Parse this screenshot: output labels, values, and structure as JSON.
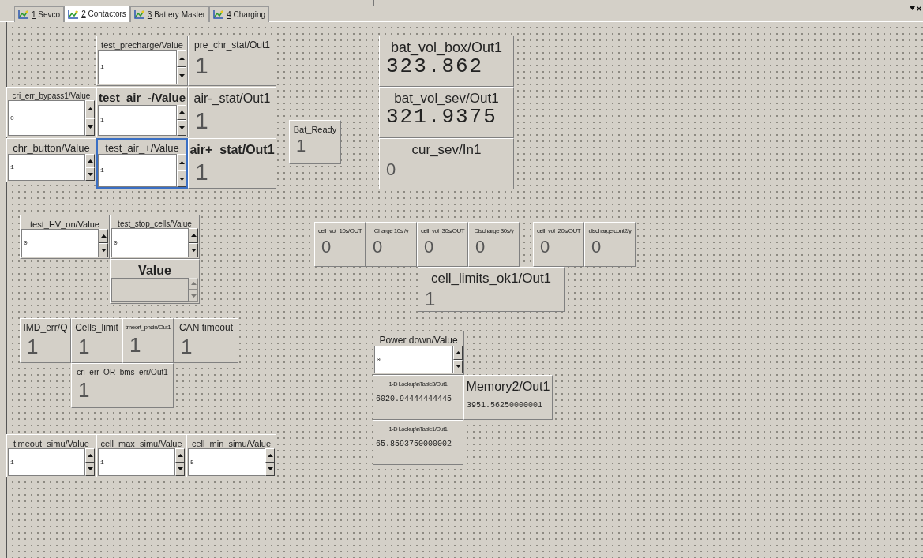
{
  "tabs": [
    {
      "key": "1",
      "label": "Sevco",
      "selected": false
    },
    {
      "key": "2",
      "label": "Contactors",
      "selected": true
    },
    {
      "key": "3",
      "label": "Battery Master",
      "selected": false
    },
    {
      "key": "4",
      "label": "Charging",
      "selected": false
    }
  ],
  "widgets": [
    {
      "kind": "input",
      "label": "test_precharge/Value",
      "value": "1",
      "disabled": false,
      "selected": false
    },
    {
      "kind": "display",
      "label": "pre_chr_stat/Out1",
      "value": "1",
      "selected": false
    },
    {
      "kind": "input",
      "label": "cri_err_bypass1/Value",
      "value": "0",
      "disabled": false,
      "selected": false
    },
    {
      "kind": "input",
      "label": "test_air_-/Value",
      "value": "1",
      "disabled": false,
      "selected": false
    },
    {
      "kind": "display",
      "label": "air-_stat/Out1",
      "value": "1",
      "selected": false
    },
    {
      "kind": "input",
      "label": "chr_button/Value",
      "value": "1",
      "disabled": false,
      "selected": false
    },
    {
      "kind": "input",
      "label": "test_air_+/Value",
      "value": "1",
      "disabled": false,
      "selected": true
    },
    {
      "kind": "display",
      "label": "air+_stat/Out1",
      "value": "1",
      "selected": false
    },
    {
      "kind": "display",
      "label": "Bat_Ready",
      "value": "1",
      "selected": false
    },
    {
      "kind": "display",
      "label": "bat_vol_box/Out1",
      "value": "323.862",
      "selected": false
    },
    {
      "kind": "display",
      "label": "bat_vol_sev/Out1",
      "value": "321.9375",
      "selected": false
    },
    {
      "kind": "display",
      "label": "cur_sev/In1",
      "value": "0",
      "selected": false
    },
    {
      "kind": "input",
      "label": "test_HV_on/Value",
      "value": "0",
      "disabled": false,
      "selected": false
    },
    {
      "kind": "input",
      "label": "test_stop_cells/Value",
      "value": "0",
      "disabled": false,
      "selected": false
    },
    {
      "kind": "input",
      "label": "Value",
      "value": "---",
      "disabled": true,
      "selected": false
    },
    {
      "kind": "display",
      "label": "IMD_err/Q",
      "value": "1",
      "selected": false
    },
    {
      "kind": "display",
      "label": "Cells_limit",
      "value": "1",
      "selected": false
    },
    {
      "kind": "display",
      "label": "tmeort_pncin/Out1",
      "value": "1",
      "selected": false
    },
    {
      "kind": "display",
      "label": "CAN timeout",
      "value": "1",
      "selected": false
    },
    {
      "kind": "display",
      "label": "cri_err_OR_bms_err/Out1",
      "value": "1",
      "selected": false
    },
    {
      "kind": "input",
      "label": "timeout_simu/Value",
      "value": "1",
      "disabled": false,
      "selected": false
    },
    {
      "kind": "input",
      "label": "cell_max_simu/Value",
      "value": "1",
      "disabled": false,
      "selected": false
    },
    {
      "kind": "input",
      "label": "cell_min_simu/Value",
      "value": "5",
      "disabled": false,
      "selected": false
    },
    {
      "kind": "display",
      "label": "cell_vol_10s/OUT",
      "value": "0",
      "selected": false
    },
    {
      "kind": "display",
      "label": "Charge 10s /y",
      "value": "0",
      "selected": false
    },
    {
      "kind": "display",
      "label": "cell_vol_30s/OUT",
      "value": "0",
      "selected": false
    },
    {
      "kind": "display",
      "label": "Discharge 30s/y",
      "value": "0",
      "selected": false
    },
    {
      "kind": "display",
      "label": "cell_vol_20s/OUT",
      "value": "0",
      "selected": false
    },
    {
      "kind": "display",
      "label": "discharge cont2/y",
      "value": "0",
      "selected": false
    },
    {
      "kind": "display",
      "label": "cell_limits_ok1/Out1",
      "value": "1",
      "selected": false
    },
    {
      "kind": "input",
      "label": "Power down/Value",
      "value": "0",
      "disabled": false,
      "selected": false
    },
    {
      "kind": "display",
      "label": "1-D Lookup\\nTable3/Out1",
      "value": "6020.94444444445",
      "selected": false
    },
    {
      "kind": "display",
      "label": "Memory2/Out1",
      "value": "3951.56250000001",
      "selected": false
    },
    {
      "kind": "display",
      "label": "1-D Lookup\\nTable1/Out1",
      "value": "65.8593750000002",
      "selected": false
    }
  ]
}
